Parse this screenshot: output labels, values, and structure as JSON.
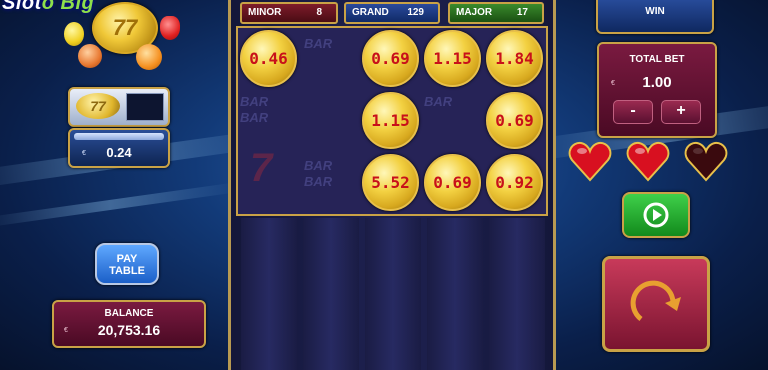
{
  "logo": {
    "prefix": "Slot",
    "suffix": "o Big",
    "coin_label": "77"
  },
  "jackpots": [
    {
      "name": "MINOR",
      "value": "8"
    },
    {
      "name": "GRAND",
      "value": "129"
    },
    {
      "name": "MAJOR",
      "value": "17"
    }
  ],
  "grid": {
    "coins": [
      {
        "row": 0,
        "col": 0,
        "value": "0.46"
      },
      {
        "row": 0,
        "col": 2,
        "value": "0.69"
      },
      {
        "row": 0,
        "col": 3,
        "value": "1.15"
      },
      {
        "row": 0,
        "col": 4,
        "value": "1.84"
      },
      {
        "row": 1,
        "col": 2,
        "value": "1.15"
      },
      {
        "row": 1,
        "col": 4,
        "value": "0.69"
      },
      {
        "row": 2,
        "col": 2,
        "value": "5.52"
      },
      {
        "row": 2,
        "col": 3,
        "value": "0.69"
      },
      {
        "row": 2,
        "col": 4,
        "value": "0.92"
      }
    ],
    "ghost_symbols": [
      "BAR",
      "BAR",
      "BAR",
      "BAR",
      "BAR",
      "BAR",
      "7"
    ]
  },
  "left": {
    "coin_selector_icon": "77",
    "stake": {
      "currency": "€",
      "value": "0.24"
    },
    "pay_table_label_1": "PAY",
    "pay_table_label_2": "TABLE",
    "balance": {
      "label": "BALANCE",
      "currency": "€",
      "value": "20,753.16"
    }
  },
  "right": {
    "win_label": "WIN",
    "total_bet": {
      "label": "TOTAL BET",
      "currency": "€",
      "value": "1.00",
      "minus": "-",
      "plus": "+"
    },
    "lives": [
      {
        "state": "full",
        "color": "#d81020"
      },
      {
        "state": "full",
        "color": "#d81020"
      },
      {
        "state": "empty",
        "color": "#3a0a0e"
      }
    ],
    "autoplay_icon": "autoplay-icon",
    "spin_icon": "spin-icon"
  },
  "colors": {
    "gold": "#c9a246",
    "coin_text": "#c8101a",
    "panel_red": "#7a1a40",
    "panel_blue": "#2a4fa0"
  }
}
